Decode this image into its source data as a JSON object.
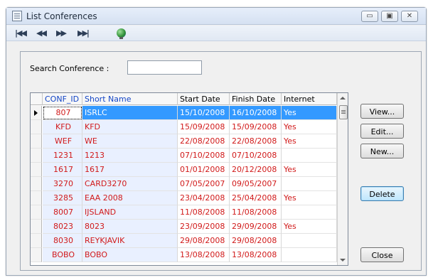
{
  "window": {
    "title": "List Conferences",
    "controls": [
      "minimize",
      "maximize",
      "close"
    ],
    "control_glyphs": {
      "minimize": "▭",
      "maximize": "▣",
      "close": "✕"
    }
  },
  "toolbar": {
    "first": "|◀◀",
    "prev": "◀◀",
    "next": "▶▶",
    "last": "▶▶|",
    "globe_icon": "globe-icon"
  },
  "search": {
    "label": "Search Conference :",
    "value": ""
  },
  "table": {
    "columns": [
      "CONF_ID",
      "Short Name",
      "Start Date",
      "Finish Date",
      "Internet forms"
    ],
    "selected_row": 0,
    "rows": [
      [
        "807",
        "ISRLC",
        "15/10/2008",
        "16/10/2008",
        "Yes"
      ],
      [
        "KFD",
        "KFD",
        "15/09/2008",
        "15/09/2008",
        "Yes"
      ],
      [
        "WEF",
        "WE",
        "22/08/2008",
        "22/08/2008",
        "Yes"
      ],
      [
        "1231",
        "1213",
        "07/10/2008",
        "07/10/2008",
        ""
      ],
      [
        "1617",
        "1617",
        "01/01/2008",
        "20/12/2008",
        "Yes"
      ],
      [
        "3270",
        "CARD3270",
        "07/05/2007",
        "09/05/2007",
        ""
      ],
      [
        "3285",
        "EAA 2008",
        "23/04/2008",
        "25/04/2008",
        "Yes"
      ],
      [
        "8007",
        "IJSLAND",
        "11/08/2008",
        "11/08/2008",
        ""
      ],
      [
        "8023",
        "8023",
        "23/09/2008",
        "29/09/2008",
        "Yes"
      ],
      [
        "8030",
        "REYKJAVIK",
        "29/08/2008",
        "29/08/2008",
        ""
      ],
      [
        "BOBO",
        "BOBO",
        "13/08/2008",
        "13/08/2008",
        ""
      ]
    ]
  },
  "buttons": {
    "view": "View...",
    "edit": "Edit...",
    "new": "New...",
    "delete": "Delete",
    "close": "Close"
  },
  "colors": {
    "row_text": "#d11a1a",
    "selection": "#3399ff",
    "header_blue": "#1446c6"
  }
}
